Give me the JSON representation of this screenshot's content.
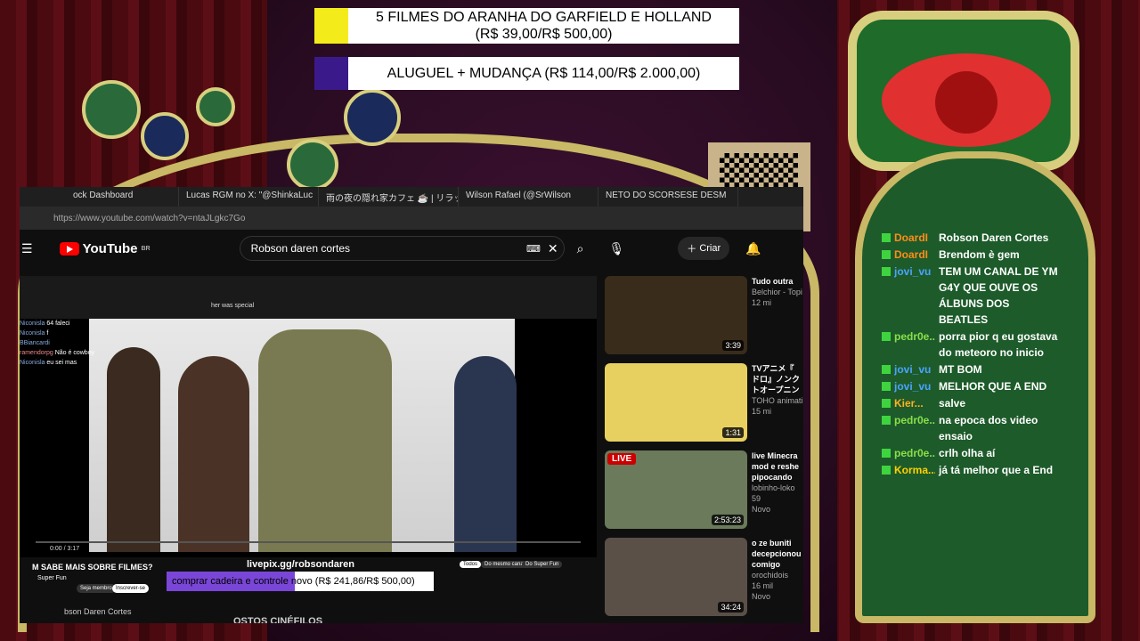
{
  "goals": [
    {
      "line1": "5 FILMES DO ARANHA DO GARFIELD E HOLLAND",
      "line2": "(R$ 39,00/R$ 500,00)",
      "color": "#f4ec1a"
    },
    {
      "line1": "ALUGUEL + MUDANÇA (R$ 114,00/R$ 2.000,00)",
      "color": "#3a1a8a"
    }
  ],
  "browser": {
    "tabs": [
      "ock Dashboard",
      "Lucas RGM no X: \"@ShinkaLuc",
      "雨の夜の隠れ家カフェ ☕ | リラック",
      "Wilson Rafael (@SrWilson",
      "NETO DO SCORSESE DESM"
    ],
    "url": "https://www.youtube.com/watch?v=ntaJLgkc7Go"
  },
  "youtube": {
    "logo": "YouTube",
    "region": "BR",
    "search": "Robson daren cortes",
    "create": "Criar"
  },
  "player": {
    "inner_search": "her was special",
    "mini_chat": [
      {
        "user": "Niconisla",
        "text": "64 faleci"
      },
      {
        "user": "Niconisla",
        "text": "f"
      },
      {
        "user": "BBiancardi",
        "text": ""
      },
      {
        "user": "ramendorpg",
        "text": "Não é cowboy"
      },
      {
        "user": "Niconisla",
        "text": "eu sei mas"
      }
    ],
    "time": "0:00 / 3:17"
  },
  "below": {
    "title": "M SABE MAIS SOBRE FILMES?",
    "channel": "Super Fun",
    "join": "Seja membro",
    "subscribe": "Inscrever-se",
    "chips": [
      "Todos",
      "Do mesmo canal",
      "Do Super Fun"
    ],
    "footer": "bson Daren Cortes",
    "footer2": "OSTOS CINÉFILOS"
  },
  "livepix": {
    "url": "livepix.gg/robsondaren",
    "label": "comprar cadeira e controle novo (R$ 241,86/R$ 500,00)",
    "progress": 0.48
  },
  "recommendations": [
    {
      "title": "Tudo outra",
      "channel": "Belchior - Topi",
      "meta": "12 mi",
      "duration": "3:39",
      "color": "#3a2c1a"
    },
    {
      "title": "TVアニメ『 ドロ』ノンク トオープニン",
      "channel": "TOHO animati",
      "meta": "15 mi",
      "duration": "1:31",
      "color": "#e8d060"
    },
    {
      "title": "live Minecra mod e reshe pipocando",
      "channel": "lobinho-loko",
      "meta": "59",
      "duration": "2:53:23",
      "live": "LIVE",
      "badge": "Novo",
      "color": "#6a7a5a"
    },
    {
      "title": "o ze buniti decepcionou comigo",
      "channel": "orochidois",
      "meta": "16 mil",
      "duration": "34:24",
      "badge": "Novo",
      "color": "#5a5048"
    }
  ],
  "chat": [
    {
      "user": "DoardI",
      "text": "Robson Daren Cortes",
      "color": "#ff8c1a"
    },
    {
      "user": "DoardI",
      "text": "Brendom è gem",
      "color": "#ff8c1a"
    },
    {
      "user": "jovi_vu",
      "text": "TEM UM CANAL DE YM G4Y QUE OUVE OS ÁLBUNS DOS BEATLES",
      "color": "#4aa3ff"
    },
    {
      "user": "pedr0e...",
      "text": "porra pior q eu gostava do meteoro no inicio",
      "color": "#8adf4a"
    },
    {
      "user": "jovi_vu",
      "text": "MT BOM",
      "color": "#4aa3ff"
    },
    {
      "user": "jovi_vu",
      "text": "MELHOR QUE A END",
      "color": "#4aa3ff"
    },
    {
      "user": "Kier...",
      "text": "salve",
      "color": "#ffb020"
    },
    {
      "user": "pedr0e...",
      "text": "na epoca dos video ensaio",
      "color": "#8adf4a"
    },
    {
      "user": "pedr0e...",
      "text": "crlh olha aí",
      "color": "#8adf4a"
    },
    {
      "user": "Korma...",
      "text": "já tá melhor que a End",
      "color": "#ffd000"
    }
  ]
}
